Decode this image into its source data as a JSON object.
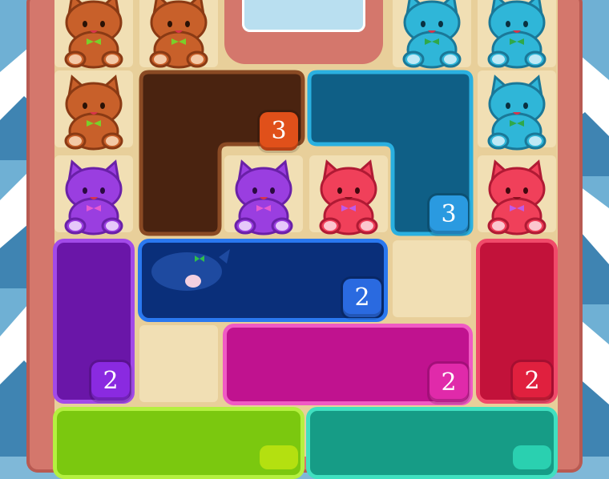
{
  "blocks": {
    "brown_l": {
      "label": "3"
    },
    "blue_l": {
      "label": "3"
    },
    "navy_bar": {
      "label": "2"
    },
    "purple_bar": {
      "label": "2"
    },
    "magenta_bar": {
      "label": "2"
    },
    "red_bar": {
      "label": "2"
    }
  },
  "colors": {
    "brown": "#4a2310",
    "blue": "#0f5f86",
    "navy": "#0a2f7a",
    "purple": "#6a16a8",
    "magenta": "#c0128f",
    "red": "#c2123a",
    "lime": "#7bc80f",
    "teal": "#169c86"
  },
  "cats": [
    {
      "color": "orange",
      "name": "cat-orange"
    },
    {
      "color": "blue",
      "name": "cat-blue"
    },
    {
      "color": "purple",
      "name": "cat-purple"
    },
    {
      "color": "pink",
      "name": "cat-pink"
    }
  ]
}
